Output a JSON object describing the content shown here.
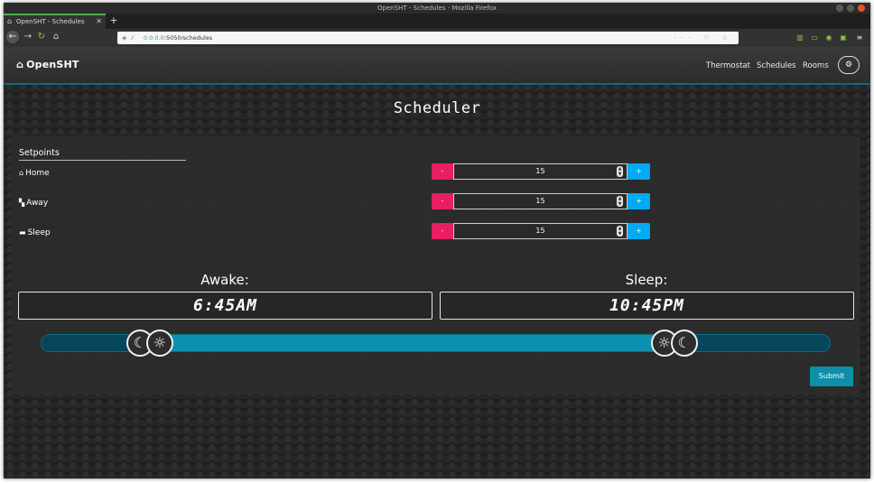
{
  "browser": {
    "window_title": "OpenSHT - Schedules - Mozilla Firefox",
    "tab_title": "OpenSHT - Schedules",
    "url_host": "0.0.0.0",
    "url_rest": ":5050/schedules",
    "url_extras": "··· ♡ ☆"
  },
  "header": {
    "brand": "OpenSHT",
    "nav": [
      "Thermostat",
      "Schedules",
      "Rooms"
    ]
  },
  "page": {
    "title": "Scheduler",
    "setpoints_title": "Setpoints",
    "setpoints": [
      {
        "label": "Home",
        "value": "15",
        "icon": "home-icon"
      },
      {
        "label": "Away",
        "value": "15",
        "icon": "door-icon"
      },
      {
        "label": "Sleep",
        "value": "15",
        "icon": "bed-icon"
      }
    ],
    "minus_label": "-",
    "plus_label": "+",
    "awake_label": "Awake:",
    "awake_time": "6:45AM",
    "sleep_label": "Sleep:",
    "sleep_time": "10:45PM",
    "slider": {
      "start_fraction": 0.142,
      "end_fraction": 0.798
    },
    "submit_label": "Submit"
  },
  "colors": {
    "accent": "#0b8faa",
    "minus": "#e91e63",
    "plus": "#03a9f4",
    "track": "#06455a",
    "range": "#0b90b0"
  }
}
